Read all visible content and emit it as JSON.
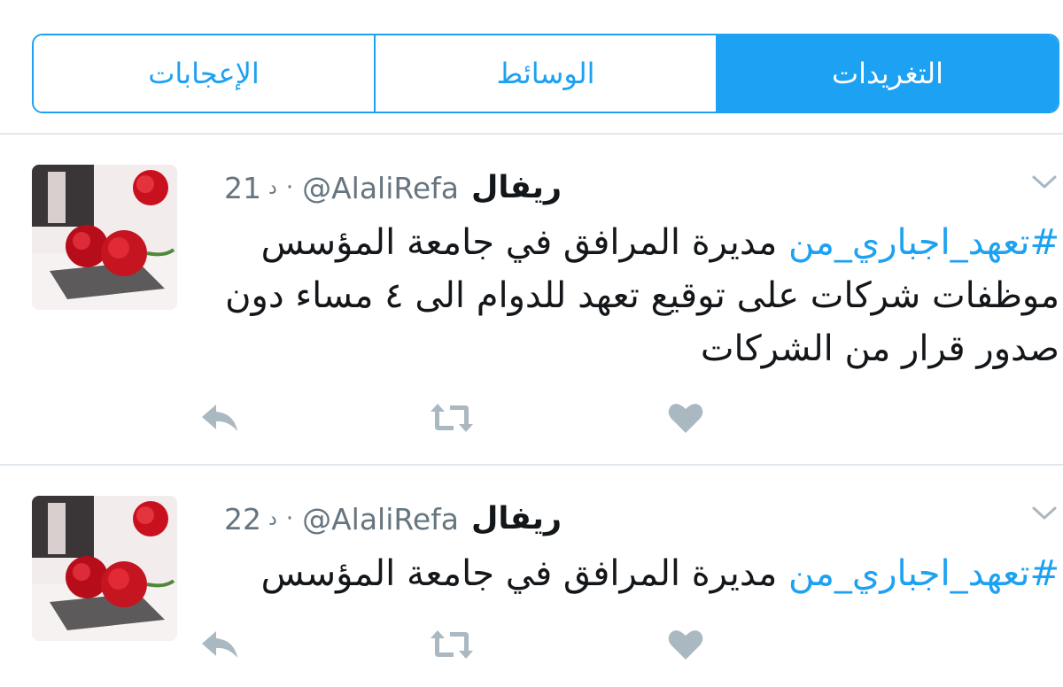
{
  "tabs": [
    {
      "label": "الإعجابات",
      "active": false
    },
    {
      "label": "الوسائط",
      "active": false
    },
    {
      "label": "التغريدات",
      "active": true
    }
  ],
  "colors": {
    "accent": "#1da1f2",
    "text": "#14171a",
    "muted": "#66757f",
    "icon": "#aab8c2",
    "divider": "#e1e8ed"
  },
  "tweets": [
    {
      "name": "ريفال",
      "handle": "@AlaliRefa",
      "time": "21",
      "time_unit": "د",
      "hashtag": "#تعهد_اجباري_من",
      "text_line1_rest": " مديرة المرافق في جامعة المؤسس",
      "text_rest": "موظفات شركات على توقيع تعهد للدوام الى ٤ مساء دون صدور قرار من الشركات",
      "icons": {
        "reply": "reply-icon",
        "retweet": "retweet-icon",
        "like": "heart-icon",
        "menu": "chevron-down-icon"
      }
    },
    {
      "name": "ريفال",
      "handle": "@AlaliRefa",
      "time": "22",
      "time_unit": "د",
      "hashtag": "#تعهد_اجباري_من",
      "text_line1_rest": " مديرة المرافق في جامعة المؤسس",
      "text_rest": "",
      "icons": {
        "reply": "reply-icon",
        "retweet": "retweet-icon",
        "like": "heart-icon",
        "menu": "chevron-down-icon"
      }
    }
  ]
}
